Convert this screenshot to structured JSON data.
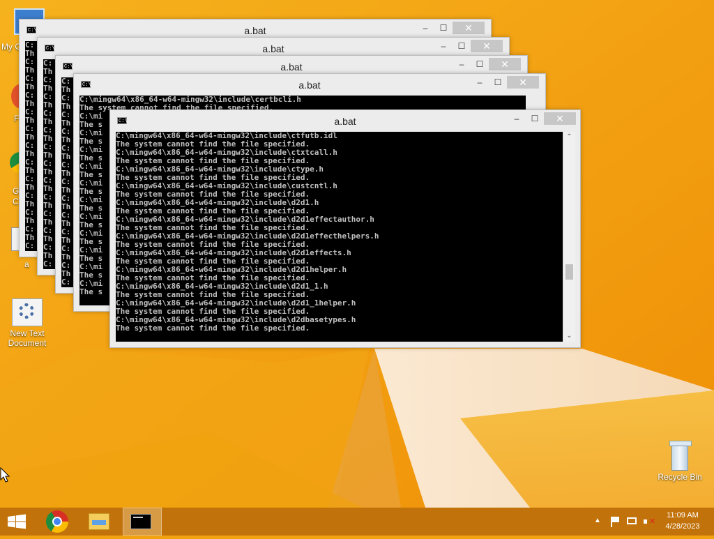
{
  "desktop": {
    "icons": [
      {
        "label": "My C"
      },
      {
        "label": "F"
      },
      {
        "label": "G"
      },
      {
        "label": "C"
      },
      {
        "label": "a"
      },
      {
        "label": "New Text Document"
      },
      {
        "label": "Recycle Bin"
      }
    ]
  },
  "windows": [
    {
      "title": "a.bat",
      "console_lines": [
        "C:",
        "Th",
        "C:",
        "Th",
        "C:",
        "Th",
        "C:",
        "Th",
        "C:",
        "Th",
        "C:",
        "Th",
        "C:",
        "Th",
        "C:",
        "Th",
        "C:",
        "Th",
        "C:",
        "Th",
        "C:",
        "Th",
        "C:",
        "Th",
        "C:",
        "Th"
      ]
    },
    {
      "title": "a.bat",
      "console_lines": [
        "C:",
        "Th",
        "C:",
        "Th",
        "C:",
        "Th",
        "C:",
        "Th",
        "C:",
        "Th",
        "C:",
        "Th",
        "C:",
        "Th",
        "C:",
        "Th",
        "C:",
        "Th",
        "C:",
        "Th",
        "C:",
        "Th",
        "C:",
        "Th",
        "C:",
        "Th"
      ]
    },
    {
      "title": "a.bat",
      "console_lines": [
        "C:",
        "Th",
        "C:",
        "Th",
        "C:",
        "Th",
        "C:",
        "Th",
        "C:",
        "Th",
        "C:",
        "Th",
        "C:",
        "Th",
        "C:",
        "Th",
        "C:",
        "Th",
        "C:",
        "Th",
        "C:",
        "Th",
        "C:",
        "Th",
        "C:",
        "Th"
      ]
    },
    {
      "title": "a.bat",
      "console_lines": [
        "C:\\mingw64\\x86_64-w64-mingw32\\include\\certbcli.h",
        "The system cannot find the file specified.",
        "C:\\mi",
        "The s",
        "C:\\mi",
        "The s",
        "C:\\mi",
        "The s",
        "C:\\mi",
        "The s",
        "C:\\mi",
        "The s",
        "C:\\mi",
        "The s",
        "C:\\mi",
        "The s",
        "C:\\mi",
        "The s",
        "C:\\mi",
        "The s",
        "C:\\mi",
        "The s",
        "C:\\mi",
        "The s"
      ]
    },
    {
      "title": "a.bat",
      "console_lines": [
        "C:\\mingw64\\x86_64-w64-mingw32\\include\\ctfutb.idl",
        "The system cannot find the file specified.",
        "C:\\mingw64\\x86_64-w64-mingw32\\include\\ctxtcall.h",
        "The system cannot find the file specified.",
        "C:\\mingw64\\x86_64-w64-mingw32\\include\\ctype.h",
        "The system cannot find the file specified.",
        "C:\\mingw64\\x86_64-w64-mingw32\\include\\custcntl.h",
        "The system cannot find the file specified.",
        "C:\\mingw64\\x86_64-w64-mingw32\\include\\d2d1.h",
        "The system cannot find the file specified.",
        "C:\\mingw64\\x86_64-w64-mingw32\\include\\d2d1effectauthor.h",
        "The system cannot find the file specified.",
        "C:\\mingw64\\x86_64-w64-mingw32\\include\\d2d1effecthelpers.h",
        "The system cannot find the file specified.",
        "C:\\mingw64\\x86_64-w64-mingw32\\include\\d2d1effects.h",
        "The system cannot find the file specified.",
        "C:\\mingw64\\x86_64-w64-mingw32\\include\\d2d1helper.h",
        "The system cannot find the file specified.",
        "C:\\mingw64\\x86_64-w64-mingw32\\include\\d2d1_1.h",
        "The system cannot find the file specified.",
        "C:\\mingw64\\x86_64-w64-mingw32\\include\\d2d1_1helper.h",
        "The system cannot find the file specified.",
        "C:\\mingw64\\x86_64-w64-mingw32\\include\\d2dbasetypes.h",
        "The system cannot find the file specified."
      ]
    }
  ],
  "window_controls": {
    "minimize": "–",
    "maximize": "☐",
    "close": "✕",
    "console_icon": "C:\\"
  },
  "taskbar": {
    "items": [
      {
        "icon": "windows-start-icon"
      },
      {
        "icon": "chrome-icon"
      },
      {
        "icon": "file-explorer-icon"
      },
      {
        "icon": "cmd-icon"
      }
    ],
    "tray": {
      "show_hidden": "▲"
    },
    "clock": {
      "time": "11:09 AM",
      "date": "4/28/2023"
    }
  },
  "colors": {
    "wallpaper": "#f3a20f",
    "console_bg": "#000000",
    "console_text": "#c0c0c0"
  }
}
